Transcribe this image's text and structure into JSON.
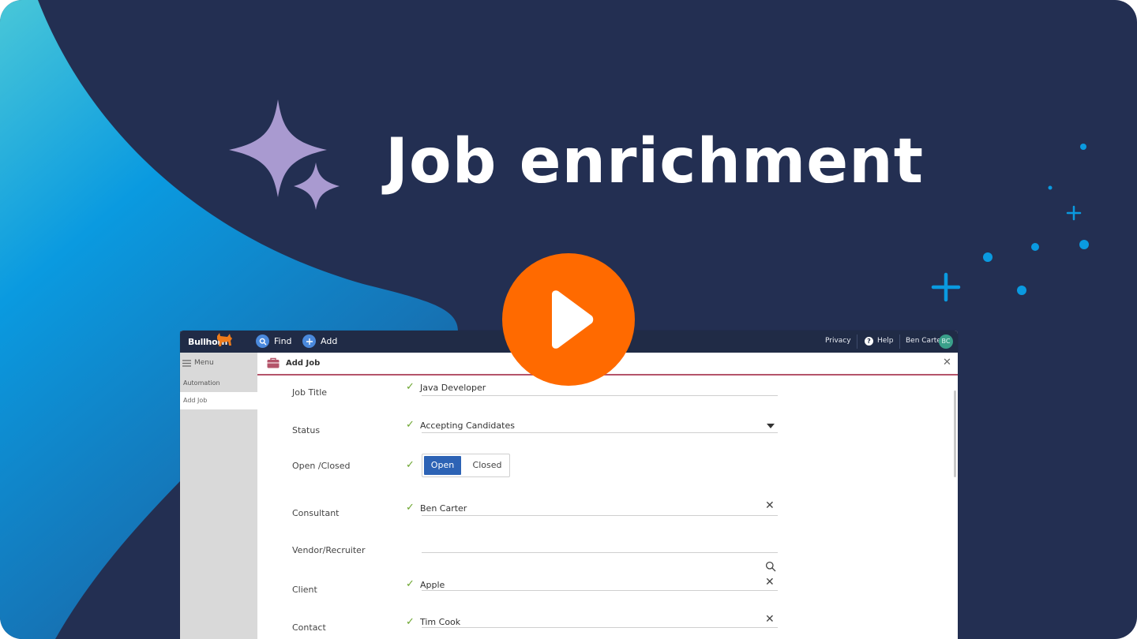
{
  "hero": {
    "title": "Job enrichment"
  },
  "colors": {
    "background": "#232f52",
    "accent_blue": "#0a9ae0",
    "play": "#ff6a00",
    "sparkle": "#a99ad0",
    "check": "#6ba52e",
    "toggle_active": "#2d63b5"
  },
  "topbar": {
    "logo": "Bullhorn",
    "find_label": "Find",
    "add_label": "Add",
    "privacy_label": "Privacy",
    "help_label": "Help",
    "user_name": "Ben Carter",
    "user_initials": "BC"
  },
  "sidebar": {
    "menu_label": "Menu",
    "items": [
      {
        "label": "Automation",
        "active": false
      },
      {
        "label": "Add Job",
        "active": true
      }
    ]
  },
  "panel": {
    "title": "Add Job",
    "fields": {
      "job_title": {
        "label": "Job Title",
        "value": "Java Developer"
      },
      "status": {
        "label": "Status",
        "value": "Accepting Candidates"
      },
      "open_closed": {
        "label": "Open /Closed",
        "open": "Open",
        "closed": "Closed",
        "selected": "Open"
      },
      "consultant": {
        "label": "Consultant",
        "value": "Ben Carter"
      },
      "vendor": {
        "label": "Vendor/Recruiter",
        "value": ""
      },
      "client": {
        "label": "Client",
        "value": "Apple"
      },
      "contact": {
        "label": "Contact",
        "value": "Tim Cook"
      }
    }
  },
  "icons": [
    "sparkle-icon",
    "play-icon",
    "search-icon",
    "plus-icon",
    "menu-icon",
    "briefcase-icon",
    "close-icon",
    "help-icon",
    "check-icon",
    "dropdown-caret-icon",
    "bull-logo-icon"
  ]
}
